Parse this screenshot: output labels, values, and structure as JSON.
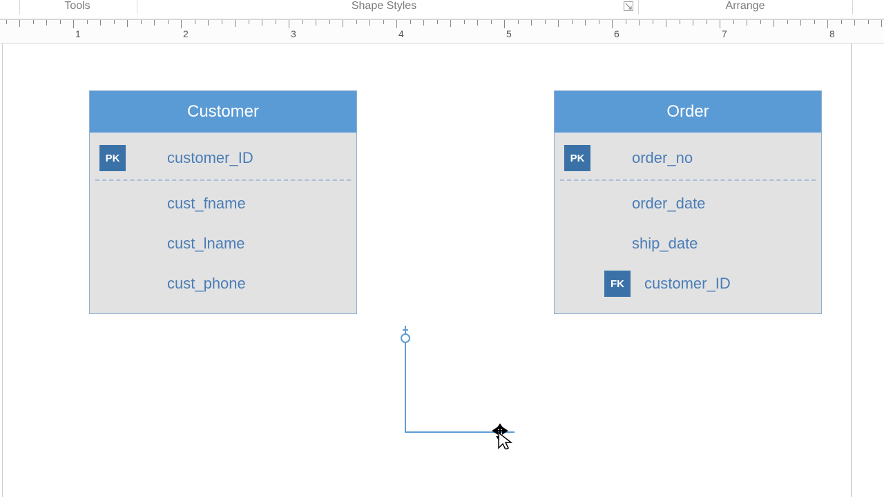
{
  "ribbon": {
    "tools": "Tools",
    "shape_styles": "Shape Styles",
    "arrange": "Arrange"
  },
  "ruler": {
    "labels": [
      "1",
      "2",
      "3",
      "4",
      "5",
      "6",
      "7",
      "8"
    ]
  },
  "entities": {
    "customer": {
      "title": "Customer",
      "rows": [
        {
          "key": "PK",
          "name": "customer_ID"
        },
        {
          "key": "",
          "name": "cust_fname"
        },
        {
          "key": "",
          "name": "cust_lname"
        },
        {
          "key": "",
          "name": "cust_phone"
        }
      ]
    },
    "order": {
      "title": "Order",
      "rows": [
        {
          "key": "PK",
          "name": "order_no"
        },
        {
          "key": "",
          "name": "order_date"
        },
        {
          "key": "",
          "name": "ship_date"
        },
        {
          "key": "FK",
          "name": "customer_ID"
        }
      ]
    }
  }
}
